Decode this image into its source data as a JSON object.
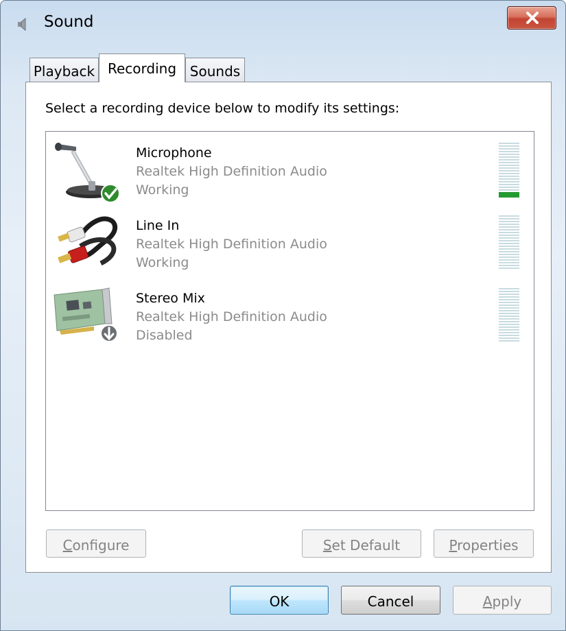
{
  "window": {
    "title": "Sound",
    "close_symbol": "×"
  },
  "tabs": [
    {
      "label": "Playback",
      "active": false
    },
    {
      "label": "Recording",
      "active": true
    },
    {
      "label": "Sounds",
      "active": false
    }
  ],
  "recording": {
    "instructions": "Select a recording device below to modify its settings:",
    "devices": [
      {
        "name": "Microphone",
        "driver": "Realtek High Definition Audio",
        "status": "Working",
        "icon": "microphone-icon",
        "status_badge": "default-check-icon",
        "level_fraction": 0.08
      },
      {
        "name": "Line In",
        "driver": "Realtek High Definition Audio",
        "status": "Working",
        "icon": "rca-cable-icon",
        "level_fraction": 0
      },
      {
        "name": "Stereo Mix",
        "driver": "Realtek High Definition Audio",
        "status": "Disabled",
        "icon": "sound-card-icon",
        "status_badge": "disabled-arrow-icon",
        "level_fraction": 0
      }
    ],
    "buttons": {
      "configure": {
        "accel": "C",
        "rest": "onfigure"
      },
      "set_default": {
        "accel": "S",
        "rest": "et Default"
      },
      "properties": {
        "accel": "P",
        "rest": "roperties"
      }
    }
  },
  "dialog_buttons": {
    "ok": "OK",
    "cancel": "Cancel",
    "apply": {
      "accel": "A",
      "rest": "pply"
    }
  },
  "colors": {
    "level_active": "#239a30",
    "level_inactive": "#c7dbe1",
    "disabled_text": "#838383",
    "secondary_text": "#8b8b8b"
  }
}
